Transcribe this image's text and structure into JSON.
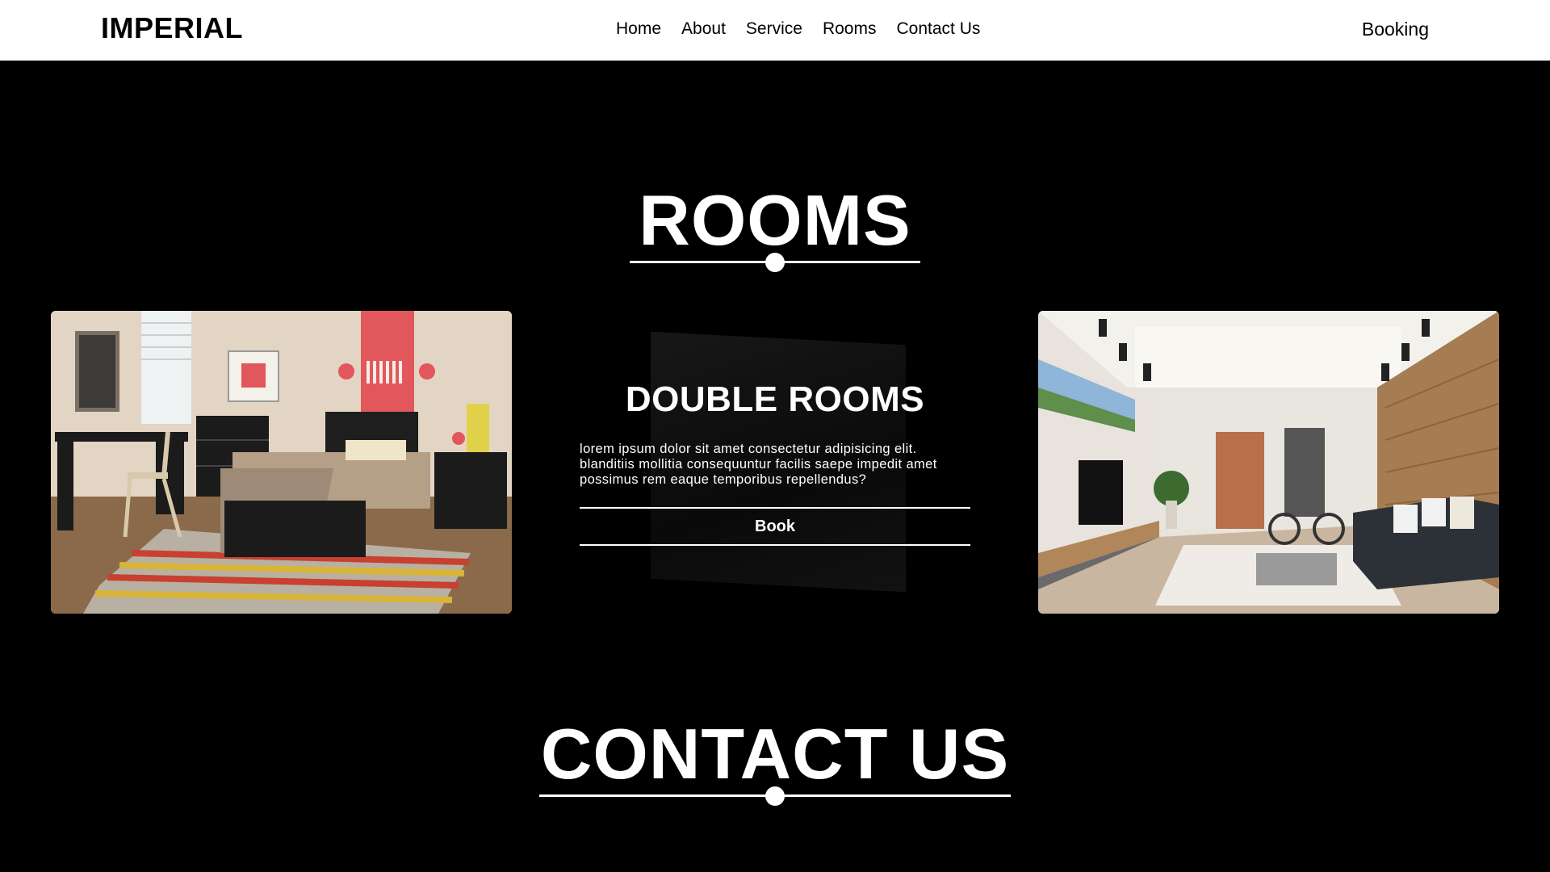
{
  "header": {
    "brand": "IMPERIAL",
    "nav": [
      "Home",
      "About",
      "Service",
      "Rooms",
      "Contact Us"
    ],
    "booking": "Booking"
  },
  "rooms_section": {
    "heading": "ROOMS",
    "left_image": "bedroom-photo",
    "right_image": "living-room-photo",
    "card": {
      "title": "DOUBLE ROOMS",
      "description": "lorem ipsum dolor sit amet consectetur adipisicing elit. blanditiis mollitia consequuntur facilis saepe impedit amet possimus rem eaque temporibus repellendus?",
      "button": "Book"
    }
  },
  "contact_section": {
    "heading": "CONTACT US"
  }
}
